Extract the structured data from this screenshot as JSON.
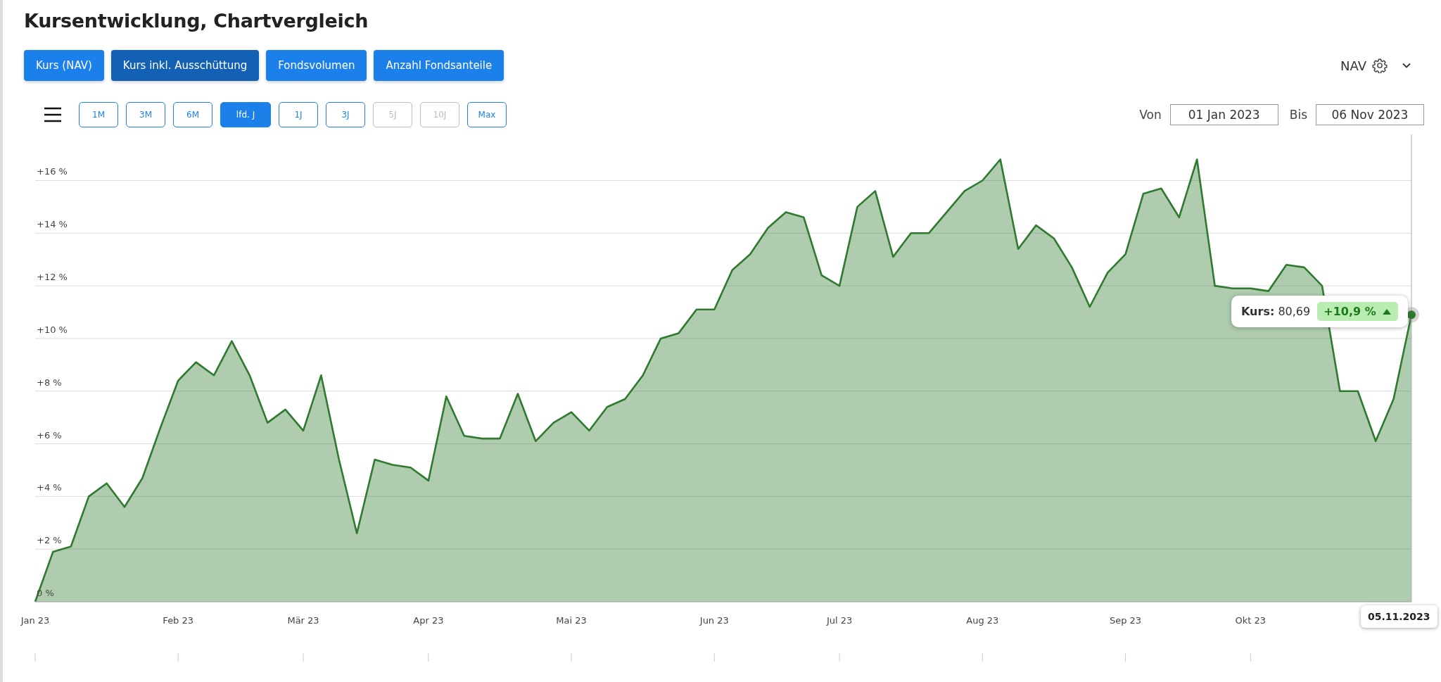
{
  "title": "Kursentwicklung, Chartvergleich",
  "views": [
    {
      "label": "Kurs (NAV)",
      "selected": false
    },
    {
      "label": "Kurs inkl. Ausschüttung",
      "selected": true
    },
    {
      "label": "Fondsvolumen",
      "selected": false
    },
    {
      "label": "Anzahl Fondsanteile",
      "selected": false
    }
  ],
  "price_type": {
    "label": "NAV"
  },
  "ranges": [
    {
      "label": "1M",
      "selected": false,
      "disabled": false
    },
    {
      "label": "3M",
      "selected": false,
      "disabled": false
    },
    {
      "label": "6M",
      "selected": false,
      "disabled": false
    },
    {
      "label": "lfd. J",
      "selected": true,
      "disabled": false
    },
    {
      "label": "1J",
      "selected": false,
      "disabled": false
    },
    {
      "label": "3J",
      "selected": false,
      "disabled": false
    },
    {
      "label": "5J",
      "selected": false,
      "disabled": true
    },
    {
      "label": "10J",
      "selected": false,
      "disabled": true
    },
    {
      "label": "Max",
      "selected": false,
      "disabled": false
    }
  ],
  "date_range": {
    "from_label": "Von",
    "from": "01 Jan 2023",
    "to_label": "Bis",
    "to": "06 Nov 2023"
  },
  "chart": {
    "chart_data": {
      "type": "area",
      "categories": [
        "Jan 23",
        null,
        null,
        null,
        null,
        null,
        null,
        null,
        "Feb 23",
        null,
        null,
        null,
        null,
        null,
        null,
        "Mär 23",
        null,
        null,
        null,
        null,
        null,
        null,
        "Apr 23",
        null,
        null,
        null,
        null,
        null,
        null,
        null,
        "Mai 23",
        null,
        null,
        null,
        null,
        null,
        null,
        null,
        "Jun 23",
        null,
        null,
        null,
        null,
        null,
        null,
        "Jul 23",
        null,
        null,
        null,
        null,
        null,
        null,
        null,
        "Aug 23",
        null,
        null,
        null,
        null,
        null,
        null,
        null,
        "Sep 23",
        null,
        null,
        null,
        null,
        null,
        null,
        "Okt 23",
        null,
        null,
        null,
        null,
        null,
        null,
        null,
        null,
        null
      ],
      "series": [
        {
          "color": "#2e7a2e",
          "values": [
            0,
            1.9,
            2.1,
            4.0,
            4.5,
            3.6,
            4.7,
            6.6,
            8.4,
            9.1,
            8.6,
            9.9,
            8.6,
            6.8,
            7.3,
            6.5,
            8.6,
            5.4,
            2.6,
            5.4,
            5.2,
            5.1,
            4.6,
            7.8,
            6.3,
            6.2,
            6.2,
            7.9,
            6.1,
            6.8,
            7.2,
            6.5,
            7.4,
            7.7,
            8.6,
            10.0,
            10.2,
            11.1,
            11.1,
            12.6,
            13.2,
            14.2,
            14.8,
            14.6,
            12.4,
            12.0,
            15.0,
            15.6,
            13.1,
            14.0,
            14.0,
            14.8,
            15.6,
            16.0,
            16.8,
            13.4,
            14.3,
            13.8,
            12.7,
            11.2,
            12.5,
            13.2,
            15.5,
            15.7,
            14.6,
            16.8,
            12.0,
            11.9,
            11.9,
            11.8,
            12.8,
            12.7,
            12.0,
            8.0,
            8.0,
            6.1,
            7.7,
            10.9
          ]
        }
      ],
      "ylim": [
        0,
        17.75
      ],
      "grid": true,
      "yticks": [
        {
          "value": 0,
          "label": "0 %"
        },
        {
          "value": 2,
          "label": "+2 %"
        },
        {
          "value": 4,
          "label": "+4 %"
        },
        {
          "value": 6,
          "label": "+6 %"
        },
        {
          "value": 8,
          "label": "+8 %"
        },
        {
          "value": 10,
          "label": "+10 %"
        },
        {
          "value": 12,
          "label": "+12 %"
        },
        {
          "value": 14,
          "label": "+14 %"
        },
        {
          "value": 16,
          "label": "+16 %"
        }
      ]
    },
    "tooltip": {
      "label": "Kurs:",
      "value": "80,69",
      "change": "+10,9 %",
      "rising": true
    },
    "cursor_date": "05.11.2023"
  }
}
